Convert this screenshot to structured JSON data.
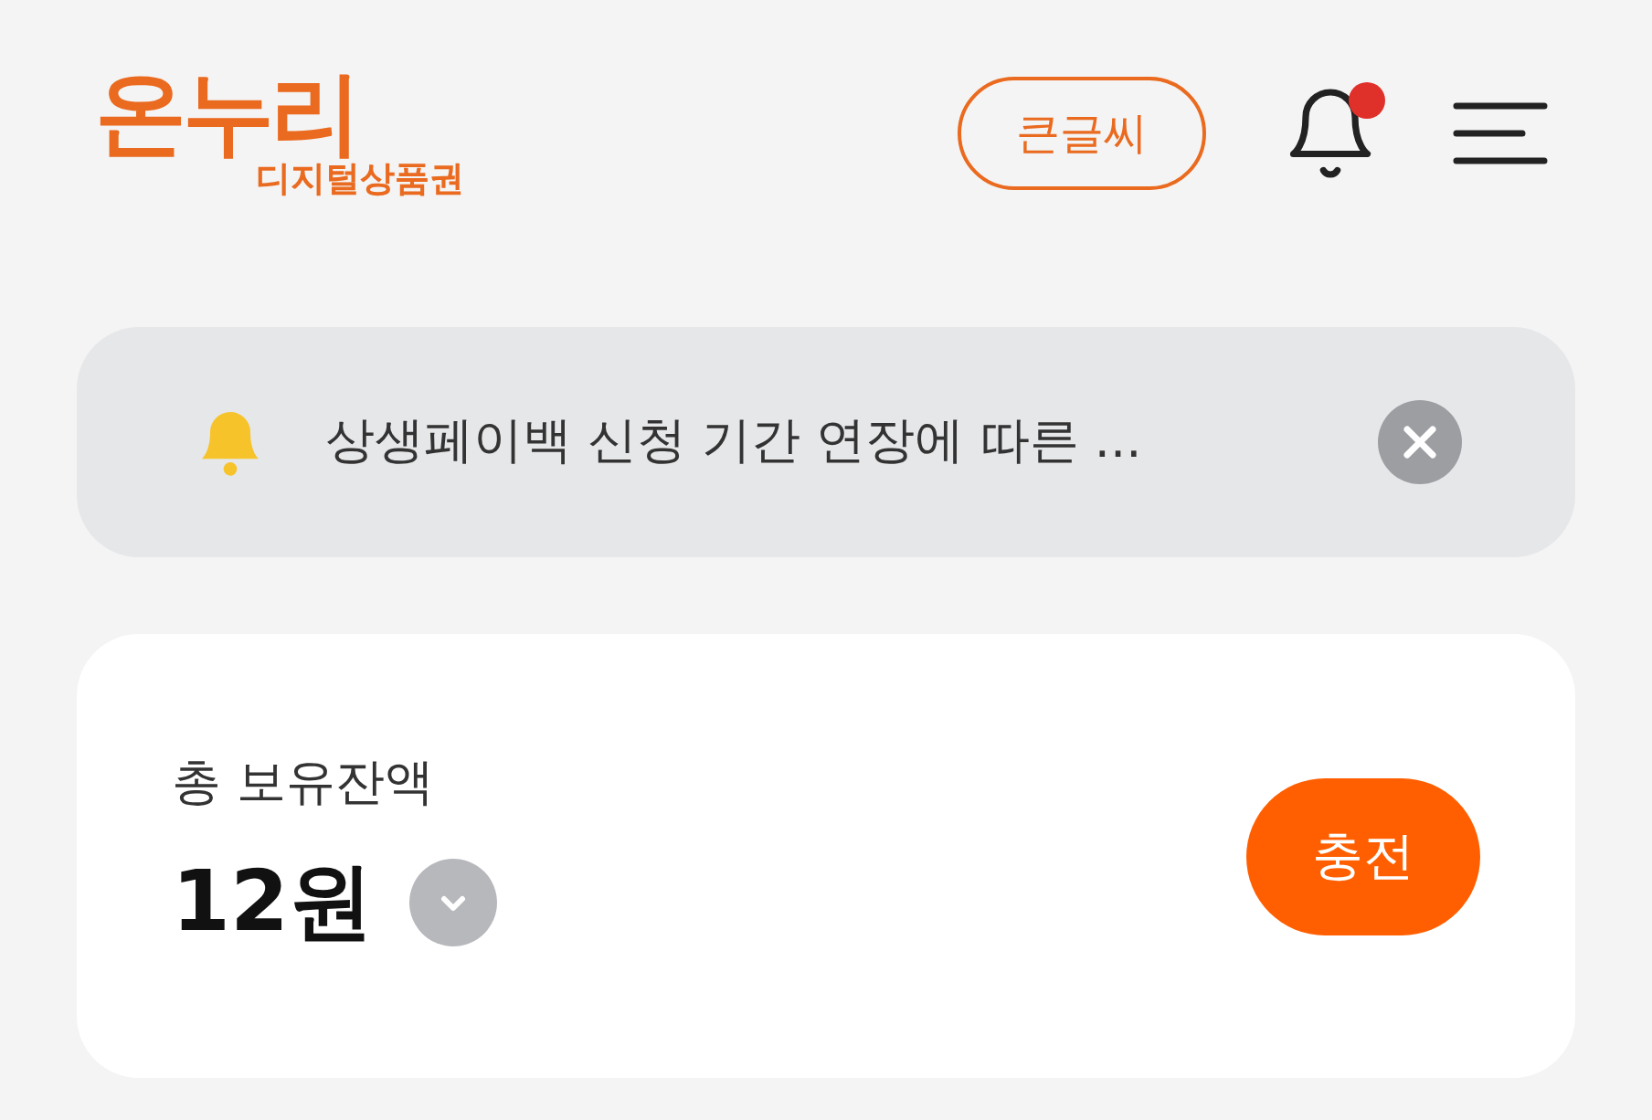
{
  "header": {
    "logo": {
      "name": "온누리",
      "subtitle": "디지털상품권"
    },
    "large_text_button": "큰글씨",
    "notifications": {
      "unread": true
    }
  },
  "notice": {
    "text": "상생페이백 신청 기간 연장에 따른 ..."
  },
  "balance": {
    "label": "총 보유잔액",
    "amount": "12원",
    "expanded": false,
    "charge_button": "충전"
  }
}
